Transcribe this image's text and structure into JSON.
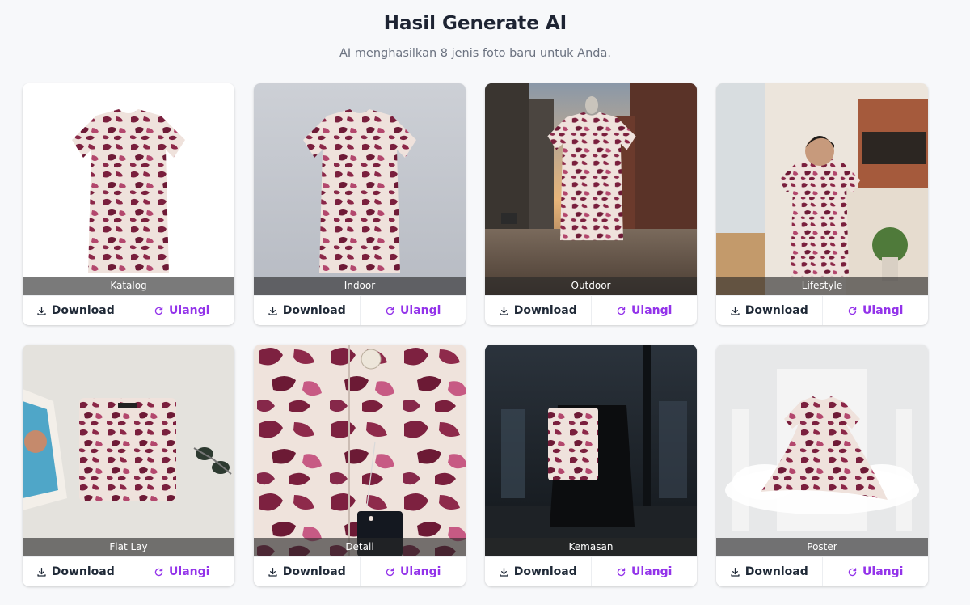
{
  "header": {
    "title": "Hasil Generate AI",
    "subtitle": "AI menghasilkan 8 jenis foto baru untuk Anda."
  },
  "actions": {
    "download_label": "Download",
    "retry_label": "Ulangi",
    "download_icon": "download-icon",
    "retry_icon": "refresh-icon"
  },
  "colors": {
    "accent": "#9333ea",
    "text_dark": "#1f2937",
    "subtitle": "#6b7280"
  },
  "cards": [
    {
      "label": "Katalog"
    },
    {
      "label": "Indoor"
    },
    {
      "label": "Outdoor"
    },
    {
      "label": "Lifestyle"
    },
    {
      "label": "Flat Lay"
    },
    {
      "label": "Detail"
    },
    {
      "label": "Kemasan"
    },
    {
      "label": "Poster"
    }
  ]
}
